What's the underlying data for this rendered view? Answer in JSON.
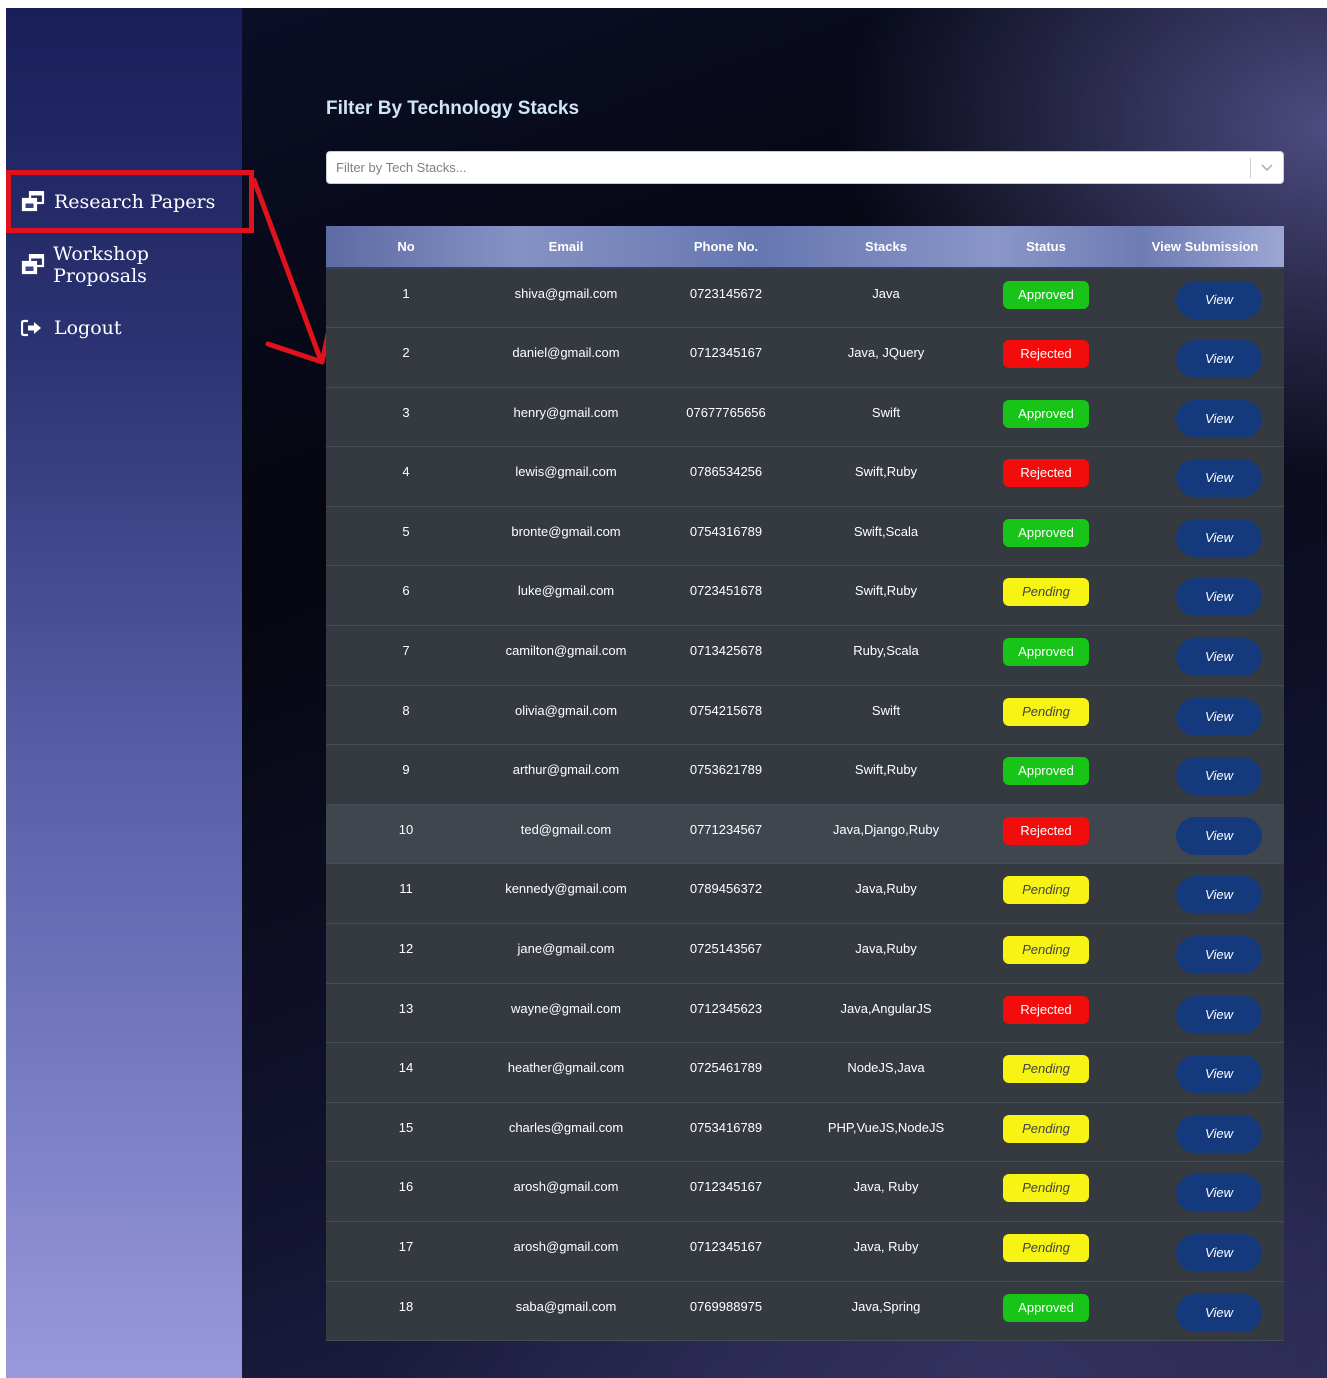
{
  "sidebar": {
    "items": [
      {
        "label": "Research Papers",
        "icon": "windows-icon"
      },
      {
        "label": "Workshop Proposals",
        "icon": "windows-icon"
      },
      {
        "label": "Logout",
        "icon": "sign-out-icon"
      }
    ]
  },
  "filter": {
    "title": "Filter By Technology Stacks",
    "placeholder": "Filter by Tech Stacks..."
  },
  "table": {
    "headers": [
      "No",
      "Email",
      "Phone No.",
      "Stacks",
      "Status",
      "View Submission"
    ],
    "view_label": "View",
    "rows": [
      {
        "no": "1",
        "email": "shiva@gmail.com",
        "phone": "0723145672",
        "stacks": "Java",
        "status": "Approved"
      },
      {
        "no": "2",
        "email": "daniel@gmail.com",
        "phone": "0712345167",
        "stacks": "Java, JQuery",
        "status": "Rejected"
      },
      {
        "no": "3",
        "email": "henry@gmail.com",
        "phone": "07677765656",
        "stacks": "Swift",
        "status": "Approved"
      },
      {
        "no": "4",
        "email": "lewis@gmail.com",
        "phone": "0786534256",
        "stacks": "Swift,Ruby",
        "status": "Rejected"
      },
      {
        "no": "5",
        "email": "bronte@gmail.com",
        "phone": "0754316789",
        "stacks": "Swift,Scala",
        "status": "Approved"
      },
      {
        "no": "6",
        "email": "luke@gmail.com",
        "phone": "0723451678",
        "stacks": "Swift,Ruby",
        "status": "Pending"
      },
      {
        "no": "7",
        "email": "camilton@gmail.com",
        "phone": "0713425678",
        "stacks": "Ruby,Scala",
        "status": "Approved"
      },
      {
        "no": "8",
        "email": "olivia@gmail.com",
        "phone": "0754215678",
        "stacks": "Swift",
        "status": "Pending"
      },
      {
        "no": "9",
        "email": "arthur@gmail.com",
        "phone": "0753621789",
        "stacks": "Swift,Ruby",
        "status": "Approved"
      },
      {
        "no": "10",
        "email": "ted@gmail.com",
        "phone": "0771234567",
        "stacks": "Java,Django,Ruby",
        "status": "Rejected"
      },
      {
        "no": "11",
        "email": "kennedy@gmail.com",
        "phone": "0789456372",
        "stacks": "Java,Ruby",
        "status": "Pending"
      },
      {
        "no": "12",
        "email": "jane@gmail.com",
        "phone": "0725143567",
        "stacks": "Java,Ruby",
        "status": "Pending"
      },
      {
        "no": "13",
        "email": "wayne@gmail.com",
        "phone": "0712345623",
        "stacks": "Java,AngularJS",
        "status": "Rejected"
      },
      {
        "no": "14",
        "email": "heather@gmail.com",
        "phone": "0725461789",
        "stacks": "NodeJS,Java",
        "status": "Pending"
      },
      {
        "no": "15",
        "email": "charles@gmail.com",
        "phone": "0753416789",
        "stacks": "PHP,VueJS,NodeJS",
        "status": "Pending"
      },
      {
        "no": "16",
        "email": "arosh@gmail.com",
        "phone": "0712345167",
        "stacks": "Java, Ruby",
        "status": "Pending"
      },
      {
        "no": "17",
        "email": "arosh@gmail.com",
        "phone": "0712345167",
        "stacks": "Java, Ruby",
        "status": "Pending"
      },
      {
        "no": "18",
        "email": "saba@gmail.com",
        "phone": "0769988975",
        "stacks": "Java,Spring",
        "status": "Approved"
      }
    ]
  },
  "colors": {
    "approved": "#17c417",
    "rejected": "#f20c0c",
    "pending": "#f7f313",
    "view_button": "#143a7d",
    "annotation": "#e0121b"
  }
}
